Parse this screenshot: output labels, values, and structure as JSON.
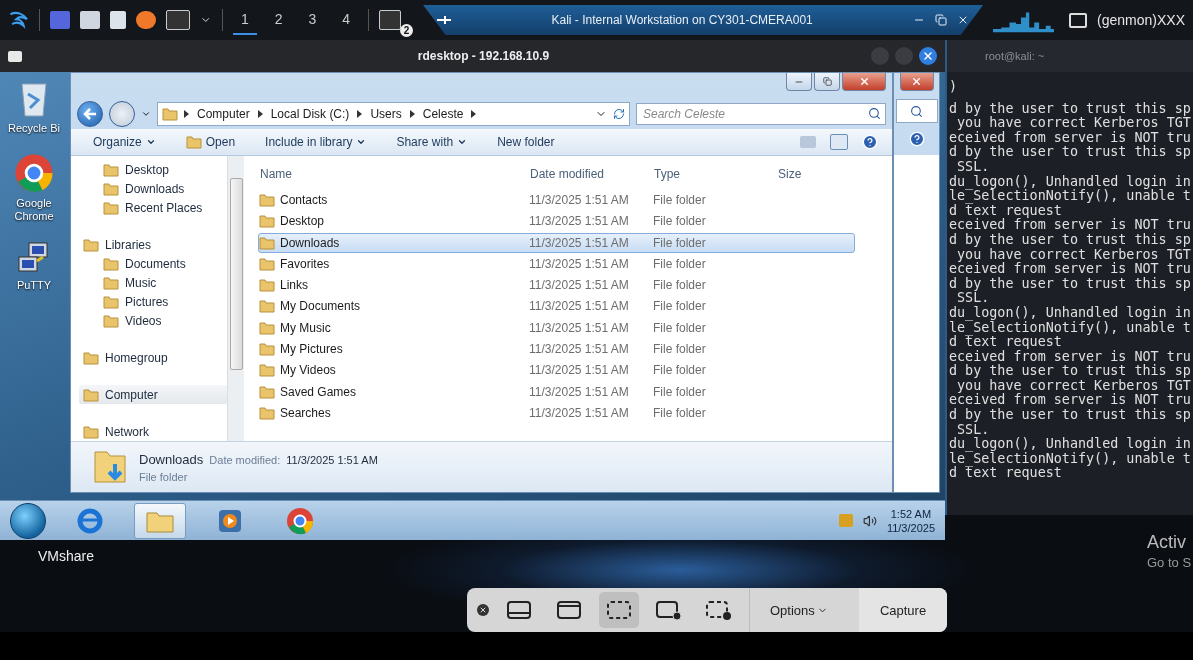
{
  "kali_panel": {
    "workspaces": [
      {
        "label": "1",
        "selected": true
      },
      {
        "label": "2",
        "selected": false
      },
      {
        "label": "3",
        "selected": false
      },
      {
        "label": "4",
        "selected": false
      }
    ],
    "badge": "2",
    "active_window": {
      "title": "Kali - Internal Workstation on CY301-CMERA001"
    },
    "genmon": "(genmon)XXX"
  },
  "rdesktop": {
    "title": "rdesktop - 192.168.10.9",
    "desktop_icons": [
      {
        "kind": "bin",
        "label": "Recycle Bi"
      },
      {
        "kind": "chrome",
        "label": "Google Chrome"
      },
      {
        "kind": "putty",
        "label": "PuTTY"
      }
    ],
    "explorer": {
      "breadcrumb": [
        "Computer",
        "Local Disk (C:)",
        "Users",
        "Celeste"
      ],
      "search": {
        "placeholder": "Search Celeste"
      },
      "toolbar": [
        {
          "label": "Organize",
          "dropdown": true
        },
        {
          "label": "Open",
          "dropdown": false
        },
        {
          "label": "Include in library",
          "dropdown": true
        },
        {
          "label": "Share with",
          "dropdown": true
        },
        {
          "label": "New folder",
          "dropdown": false
        }
      ],
      "nav_pane": [
        {
          "children": [
            {
              "label": "Desktop",
              "selected": false
            },
            {
              "label": "Downloads",
              "selected": false
            },
            {
              "label": "Recent Places",
              "selected": false
            }
          ]
        },
        {
          "label": "Libraries",
          "selected": false,
          "children": [
            {
              "label": "Documents",
              "selected": false
            },
            {
              "label": "Music",
              "selected": false
            },
            {
              "label": "Pictures",
              "selected": false
            },
            {
              "label": "Videos",
              "selected": false
            }
          ]
        },
        {
          "label": "Homegroup",
          "selected": false
        },
        {
          "label": "Computer",
          "selected": true
        },
        {
          "label": "Network",
          "selected": false
        }
      ],
      "columns": [
        "Name",
        "Date modified",
        "Type",
        "Size"
      ],
      "rows": [
        {
          "name": "Contacts",
          "date": "11/3/2025 1:51 AM",
          "type": "File folder",
          "selected": false
        },
        {
          "name": "Desktop",
          "date": "11/3/2025 1:51 AM",
          "type": "File folder",
          "selected": false
        },
        {
          "name": "Downloads",
          "date": "11/3/2025 1:51 AM",
          "type": "File folder",
          "selected": true
        },
        {
          "name": "Favorites",
          "date": "11/3/2025 1:51 AM",
          "type": "File folder",
          "selected": false
        },
        {
          "name": "Links",
          "date": "11/3/2025 1:51 AM",
          "type": "File folder",
          "selected": false
        },
        {
          "name": "My Documents",
          "date": "11/3/2025 1:51 AM",
          "type": "File folder",
          "selected": false
        },
        {
          "name": "My Music",
          "date": "11/3/2025 1:51 AM",
          "type": "File folder",
          "selected": false
        },
        {
          "name": "My Pictures",
          "date": "11/3/2025 1:51 AM",
          "type": "File folder",
          "selected": false
        },
        {
          "name": "My Videos",
          "date": "11/3/2025 1:51 AM",
          "type": "File folder",
          "selected": false
        },
        {
          "name": "Saved Games",
          "date": "11/3/2025 1:51 AM",
          "type": "File folder",
          "selected": false
        },
        {
          "name": "Searches",
          "date": "11/3/2025 1:51 AM",
          "type": "File folder",
          "selected": false
        }
      ],
      "details": {
        "name": "Downloads",
        "label": "Date modified:",
        "value": "11/3/2025 1:51 AM",
        "type": "File folder"
      }
    },
    "taskbar": {
      "apps": [
        {
          "kind": "ie",
          "selected": false
        },
        {
          "kind": "explorer",
          "selected": true
        },
        {
          "kind": "player",
          "selected": false
        },
        {
          "kind": "chrome",
          "selected": false
        }
      ],
      "clock": {
        "time": "1:52 AM",
        "date": "11/3/2025"
      }
    }
  },
  "terminal": {
    "title": "root@kali: ~",
    "lines": [
      ")",
      "d by the user to trust this sp",
      " you have correct Kerberos TGT",
      "eceived from server is NOT tru",
      "d by the user to trust this sp",
      " SSL.",
      "du_logon(), Unhandled login in",
      "le_SelectionNotify(), unable t",
      "d text request",
      "eceived from server is NOT tru",
      "d by the user to trust this sp",
      " you have correct Kerberos TGT",
      "eceived from server is NOT tru",
      "d by the user to trust this sp",
      " SSL.",
      "du_logon(), Unhandled login in",
      "le_SelectionNotify(), unable t",
      "d text request",
      "eceived from server is NOT tru",
      "d by the user to trust this sp",
      " you have correct Kerberos TGT",
      "eceived from server is NOT tru",
      "d by the user to trust this sp",
      " SSL.",
      "du_logon(), Unhandled login in",
      "le_SelectionNotify(), unable t",
      "d text request"
    ]
  },
  "desktop": {
    "folder": "VMshare",
    "activation": [
      "Activ",
      "Go to S"
    ]
  },
  "capture_bar": {
    "modes": [
      {
        "kind": "screen",
        "selected": false
      },
      {
        "kind": "window",
        "selected": false
      },
      {
        "kind": "selection",
        "selected": true
      },
      {
        "kind": "record-screen",
        "selected": false
      },
      {
        "kind": "record-selection",
        "selected": false
      }
    ],
    "options": "Options",
    "capture": "Capture"
  }
}
